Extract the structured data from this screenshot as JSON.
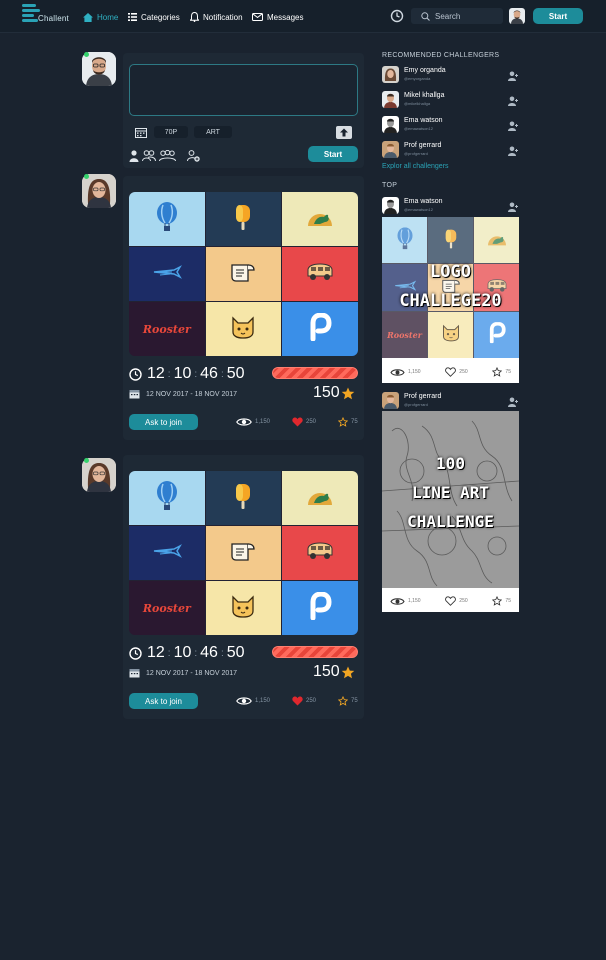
{
  "nav": {
    "logo_text": "Challent",
    "items": [
      {
        "label": "Home",
        "icon": "home-icon"
      },
      {
        "label": "Categories",
        "icon": "list-icon"
      },
      {
        "label": "Notification",
        "icon": "bell-icon"
      },
      {
        "label": "Messages",
        "icon": "mail-icon"
      }
    ],
    "search_placeholder": "Search",
    "start_label": "Start"
  },
  "composer": {
    "tag_points": "70P",
    "tag_category": "ART",
    "start_label": "Start"
  },
  "posts": [
    {
      "timer": {
        "h": "12",
        "m": "10",
        "s": "46",
        "f": "50"
      },
      "progress": 1.0,
      "dates": "12 NOV 2017 - 18 NOV 2017",
      "score": "150",
      "ask_label": "Ask to join",
      "views": "1,150",
      "likes": "250",
      "stars": "75"
    },
    {
      "timer": {
        "h": "12",
        "m": "10",
        "s": "46",
        "f": "50"
      },
      "progress": 1.0,
      "dates": "12 NOV 2017 - 18 NOV 2017",
      "score": "150",
      "ask_label": "Ask to join",
      "views": "1,150",
      "likes": "250",
      "stars": "75"
    }
  ],
  "grid_tiles": [
    {
      "icon": "balloon-icon",
      "bg": "#a8d8f0"
    },
    {
      "icon": "popsicle-icon",
      "bg": "#233b55"
    },
    {
      "icon": "kangaroo-icon",
      "bg": "#eee9b8"
    },
    {
      "icon": "bird-icon",
      "bg": "#1c2c66"
    },
    {
      "icon": "document-icon",
      "bg": "#f3c98b"
    },
    {
      "icon": "van-icon",
      "bg": "#e8484a"
    },
    {
      "icon": "rooster-wordmark",
      "bg": "#2a1830",
      "text": "Rooster"
    },
    {
      "icon": "cat-icon",
      "bg": "#f6e6a8"
    },
    {
      "icon": "p-icon",
      "bg": "#3a8fe8"
    }
  ],
  "sidebar": {
    "recommended_title": "RECOMMENDED CHALLENGERS",
    "challengers": [
      {
        "name": "Emy organda",
        "handle": "@emyorganda"
      },
      {
        "name": "Mikel khallga",
        "handle": "@mikelkhallga"
      },
      {
        "name": "Ema watson",
        "handle": "@emawatson12"
      },
      {
        "name": "Prof gerrard",
        "handle": "@profgerrard"
      }
    ],
    "explore_label": "Explor all challengers",
    "top_title": "TOP",
    "top_posts": [
      {
        "name": "Ema watson",
        "handle": "@emawatson12",
        "overlay": [
          "LOGO",
          "CHALLEGE20"
        ],
        "views": "1,150",
        "likes": "250",
        "stars": "75"
      },
      {
        "name": "Prof gerrard",
        "handle": "@profgerrard",
        "overlay": [
          "100",
          "LINE ART",
          "CHALLENGE"
        ],
        "views": "1,150",
        "likes": "250",
        "stars": "75"
      }
    ]
  },
  "colors": {
    "background": "#1a232f",
    "card": "#1e2935",
    "accent": "#1d8c9a",
    "link": "#2aa3b6",
    "online": "#33d16b",
    "progress": "#e8453a",
    "heart": "#e0282e",
    "star": "#f2a623"
  }
}
